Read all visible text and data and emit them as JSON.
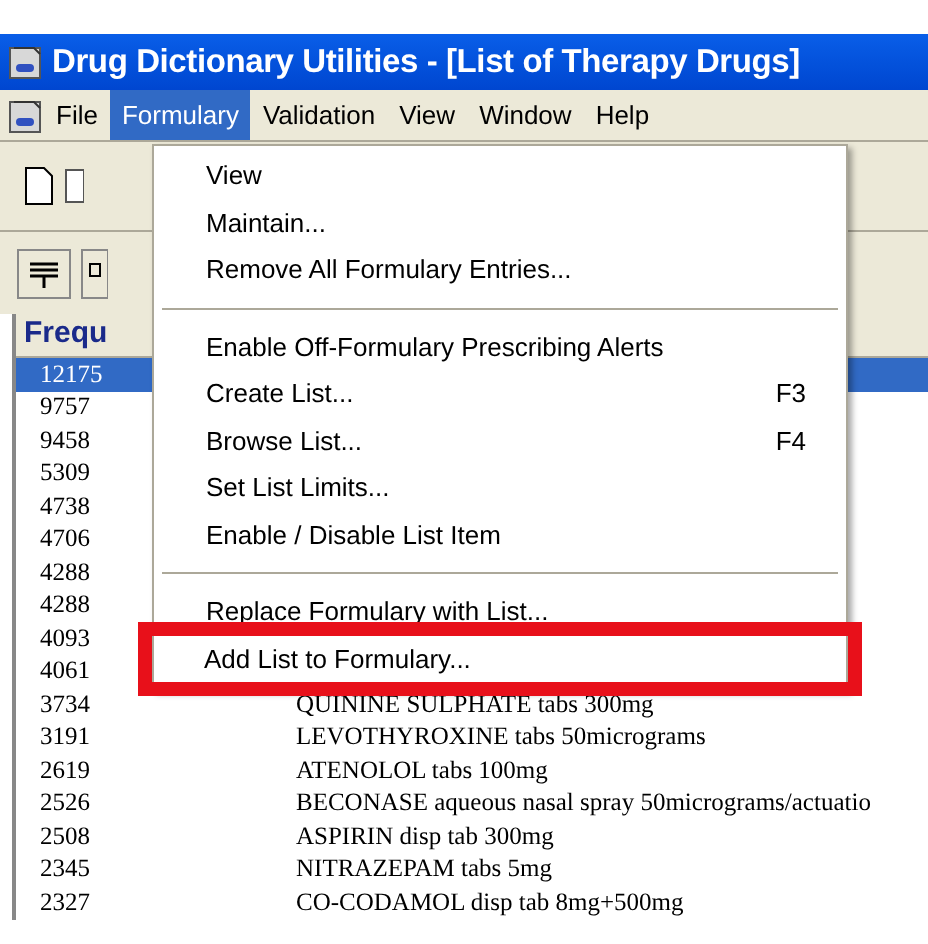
{
  "window": {
    "title": "Drug Dictionary Utilities - [List of Therapy Drugs]"
  },
  "menu_bar": [
    {
      "label": "File",
      "selected": false
    },
    {
      "label": "Formulary",
      "selected": true
    },
    {
      "label": "Validation",
      "selected": false
    },
    {
      "label": "View",
      "selected": false
    },
    {
      "label": "Window",
      "selected": false
    },
    {
      "label": "Help",
      "selected": false
    }
  ],
  "dropdown": [
    {
      "kind": "item",
      "label": "View",
      "highlighted": false
    },
    {
      "kind": "item",
      "label": "Maintain...",
      "highlighted": false
    },
    {
      "kind": "item",
      "label": "Remove All Formulary Entries...",
      "highlighted": false
    },
    {
      "kind": "separator"
    },
    {
      "kind": "item",
      "label": "Enable Off-Formulary Prescribing Alerts",
      "highlighted": false
    },
    {
      "kind": "item",
      "label": "Create List...",
      "shortcut": "F3",
      "highlighted": false
    },
    {
      "kind": "item",
      "label": "Browse List...",
      "shortcut": "F4",
      "highlighted": false
    },
    {
      "kind": "item",
      "label": "Set List Limits...",
      "highlighted": false
    },
    {
      "kind": "item",
      "label": "Enable / Disable List Item",
      "highlighted": false
    },
    {
      "kind": "separator"
    },
    {
      "kind": "item",
      "label": "Replace Formulary with List...",
      "highlighted": false
    },
    {
      "kind": "item",
      "label": "Add List to Formulary...",
      "highlighted": true
    }
  ],
  "list": {
    "column_1": "Frequ",
    "rows": [
      {
        "frequency": "12175",
        "selected": true
      },
      {
        "frequency": "9757",
        "selected": false
      },
      {
        "frequency": "9458",
        "selected": false
      },
      {
        "frequency": "5309",
        "selected": false
      },
      {
        "frequency": "4738",
        "selected": false
      },
      {
        "frequency": "4706",
        "selected": false
      },
      {
        "frequency": "4288",
        "selected": false
      },
      {
        "frequency": "4288",
        "selected": false
      },
      {
        "frequency": "4093",
        "selected": false
      },
      {
        "frequency": "4061",
        "selected": false
      },
      {
        "frequency": "3734",
        "drug": "QUININE SULPHATE tabs 300mg",
        "selected": false
      },
      {
        "frequency": "3191",
        "drug": "LEVOTHYROXINE tabs 50micrograms",
        "selected": false
      },
      {
        "frequency": "2619",
        "drug": "ATENOLOL tabs 100mg",
        "selected": false
      },
      {
        "frequency": "2526",
        "drug": "BECONASE aqueous nasal spray 50micrograms/actuatio",
        "selected": false
      },
      {
        "frequency": "2508",
        "drug": "ASPIRIN disp tab 300mg",
        "selected": false
      },
      {
        "frequency": "2345",
        "drug": "NITRAZEPAM tabs 5mg",
        "selected": false
      },
      {
        "frequency": "2327",
        "drug": "CO-CODAMOL disp tab 8mg+500mg",
        "selected": false
      }
    ]
  }
}
